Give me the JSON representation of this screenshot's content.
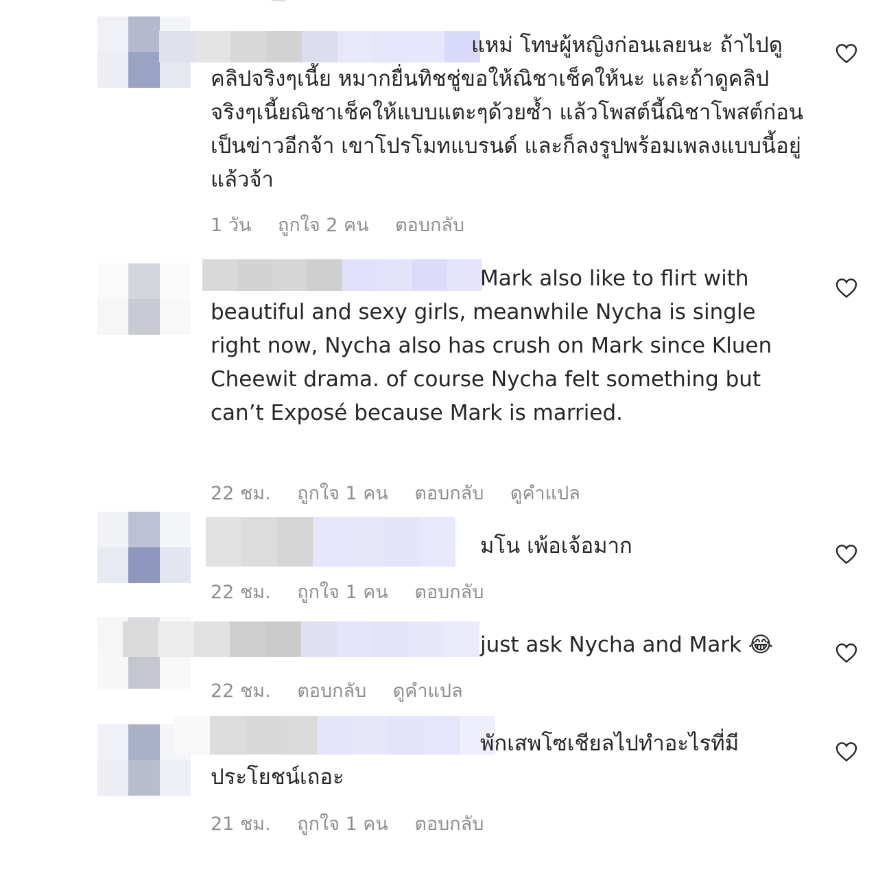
{
  "comments": [
    {
      "text": "แหม่ โทษผู้หญิงก่อนเลยนะ ถ้าไปดูคลิปจริงๆเนี้ย หมากยื่นทิชชู่ขอให้ณิชาเช็คให้นะ และถ้าดูคลิปจริงๆเนี้ยณิชาเช็คให้แบบแตะๆด้วยซ้ำ แล้วโพสต์นี้ณิชาโพสต์ก่อนเป็นข่าวอีกจ้า เขาโปรโมทแบรนด์ และก็ลงรูปพร้อมเพลงแบบนี้อยู่แล้วจ้า",
      "time": "1 วัน",
      "likes": "ถูกใจ 2 คน",
      "reply": "ตอบกลับ"
    },
    {
      "text": "Mark also like to flirt with beautiful and sexy girls, meanwhile Nycha is single right now, Nycha also has crush on Mark since Kluen Cheewit drama. of course Nycha felt something but can’t Exposé because Mark is married.",
      "time": "22 ชม.",
      "likes": "ถูกใจ 1 คน",
      "reply": "ตอบกลับ",
      "translate": "ดูคำแปล"
    },
    {
      "text": "มโน เพ้อเจ้อมาก",
      "time": "22 ชม.",
      "likes": "ถูกใจ 1 คน",
      "reply": "ตอบกลับ"
    },
    {
      "text": "just ask Nycha and Mark 😂",
      "time": "22 ชม.",
      "reply": "ตอบกลับ",
      "translate": "ดูคำแปล"
    },
    {
      "text": "พักเสพโซเชียลไปทำอะไรที่มีประโยชน์เถอะ",
      "time": "21 ชม.",
      "likes": "ถูกใจ 1 คน",
      "reply": "ตอบกลับ"
    }
  ],
  "icons": {
    "like": "heart-outline-icon"
  },
  "colors": {
    "text": "#262626",
    "meta": "#8e8e8e",
    "background": "#ffffff"
  }
}
